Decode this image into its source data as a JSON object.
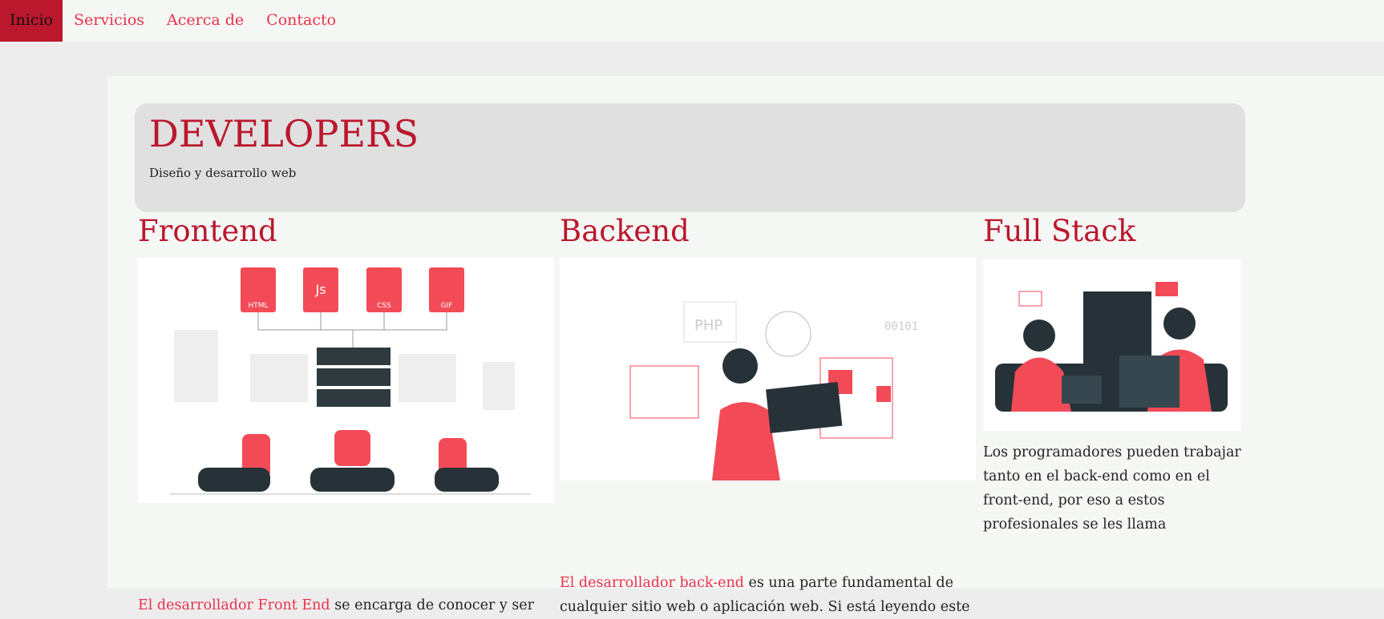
{
  "nav": {
    "items": [
      {
        "label": "Inicio",
        "active": true
      },
      {
        "label": "Servicios"
      },
      {
        "label": "Acerca de"
      },
      {
        "label": "Contacto"
      }
    ]
  },
  "jumbotron": {
    "title": "DEVELOPERS",
    "subtitle": "Diseño y desarrollo web"
  },
  "columns": [
    {
      "title": "Frontend",
      "image": "frontend-illustration",
      "link": "El desarrollador Front End",
      "text": " se encarga de conocer y ser"
    },
    {
      "title": "Backend",
      "image": "backend-illustration",
      "link": "El desarrollador back-end",
      "text": " es una parte fundamental de cualquier sitio web o aplicación web. Si está leyendo este"
    },
    {
      "title": "Full Stack",
      "image": "fullstack-illustration",
      "text": "Los programadores pueden trabajar tanto en el back-end como en el front-end, por eso a estos profesionales se les llama"
    }
  ],
  "illustration_labels": {
    "html": "HTML",
    "js": "Js",
    "css": "CSS",
    "gif": "GIF",
    "php": "PHP",
    "binary": "00101"
  },
  "colors": {
    "accent": "#bb172d",
    "link": "#e8324a",
    "illustration": "#f24b57"
  }
}
